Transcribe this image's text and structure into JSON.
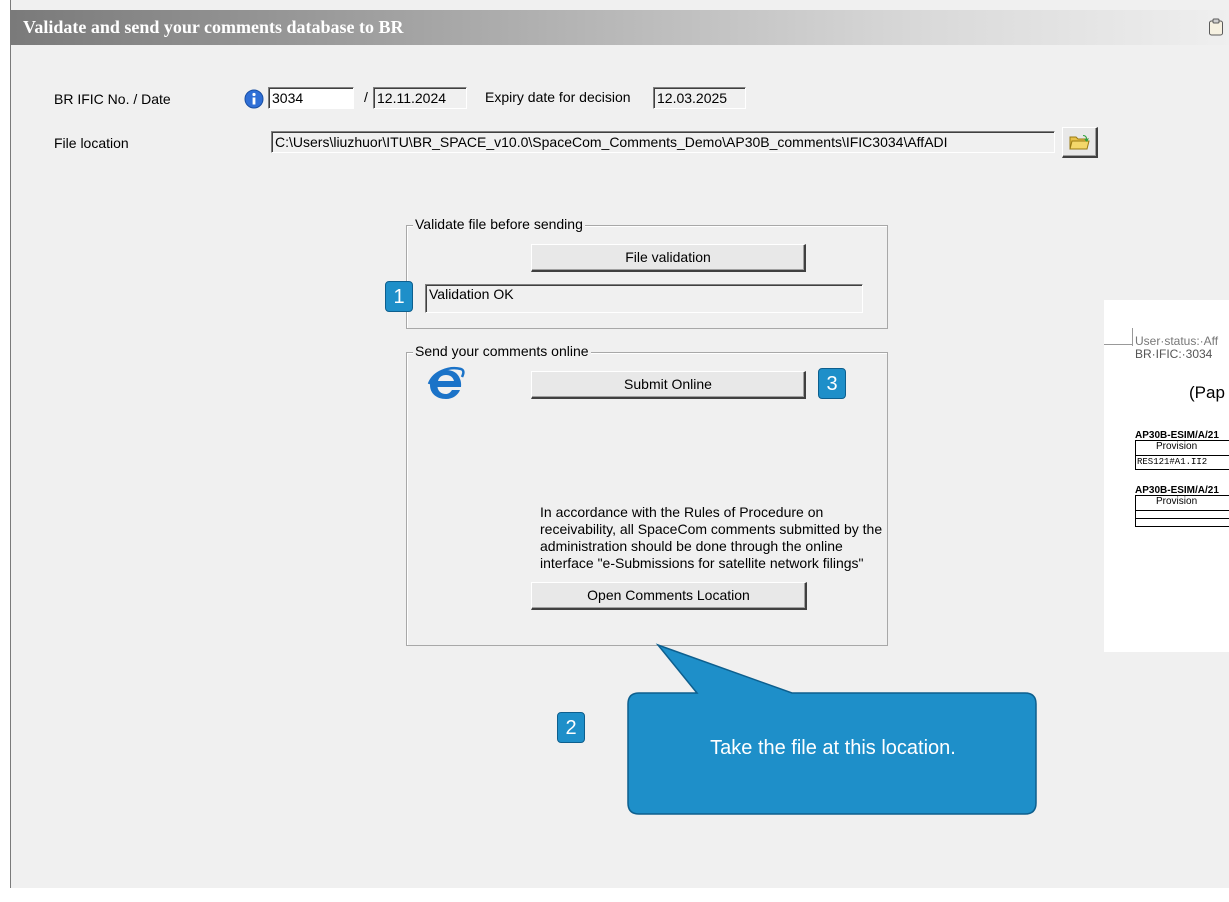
{
  "window": {
    "title": "Validate and send your comments database to BR",
    "icon": "clipboard-icon"
  },
  "form": {
    "ific_label": "BR IFIC No. / Date",
    "info_icon": "info-icon",
    "ific_number": "3034",
    "date_separator": "/",
    "ific_date": "12.11.2024",
    "expiry_label": "Expiry date for decision",
    "expiry_date": "12.03.2025",
    "file_location_label": "File location",
    "file_location_value": "C:\\Users\\liuzhuor\\ITU\\BR_SPACE_v10.0\\SpaceCom_Comments_Demo\\AP30B_comments\\IFIC3034\\AffADI",
    "browse_icon": "open-folder-icon"
  },
  "validate_group": {
    "legend": "Validate file before sending",
    "button": "File validation",
    "status": "Validation OK"
  },
  "send_group": {
    "legend": "Send your comments online",
    "ie_icon": "internet-explorer-icon",
    "submit_button": "Submit Online",
    "note": "In accordance with the Rules of Procedure on receivability, all SpaceCom comments submitted by the administration should be done through the online interface \"e-Submissions for satellite network filings\"",
    "open_location_button": "Open Comments Location"
  },
  "annotations": {
    "badge_1": "1",
    "badge_2": "2",
    "badge_3": "3",
    "callout": "Take the file at this location."
  },
  "doc_preview": {
    "status_line": "User·status:·Aff",
    "ific_line": "BR·IFIC:·3034",
    "heading": "(Pap",
    "section1": "AP30B-ESIM/A/21",
    "provision1": "Provision",
    "cell1": "RES121#A1.II2",
    "section2": "AP30B-ESIM/A/21",
    "provision2": "Provision"
  },
  "colors": {
    "accent": "#1e8fc9",
    "callout": "#1e8fc9",
    "titlebar_start": "#7a7a7a"
  }
}
